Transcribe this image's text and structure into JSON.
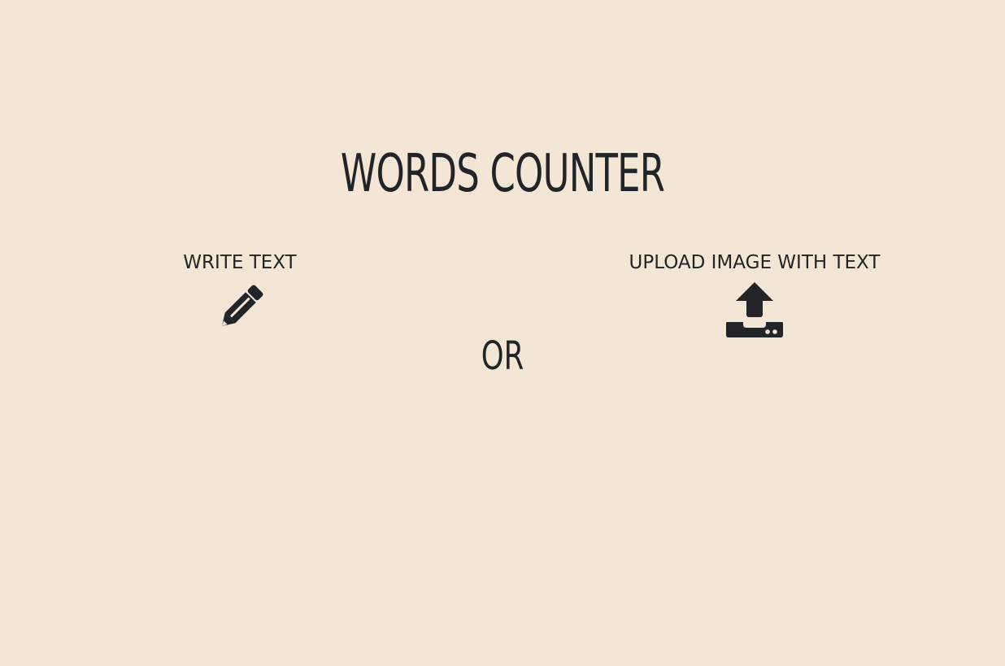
{
  "header": {
    "title": "WORDS COUNTER"
  },
  "options": {
    "write": {
      "label": "WRITE TEXT",
      "icon": "pencil-icon"
    },
    "separator": "OR",
    "upload": {
      "label": "UPLOAD IMAGE WITH TEXT",
      "icon": "upload-icon"
    }
  },
  "colors": {
    "background": "#f4e6d4",
    "text": "#212529"
  }
}
